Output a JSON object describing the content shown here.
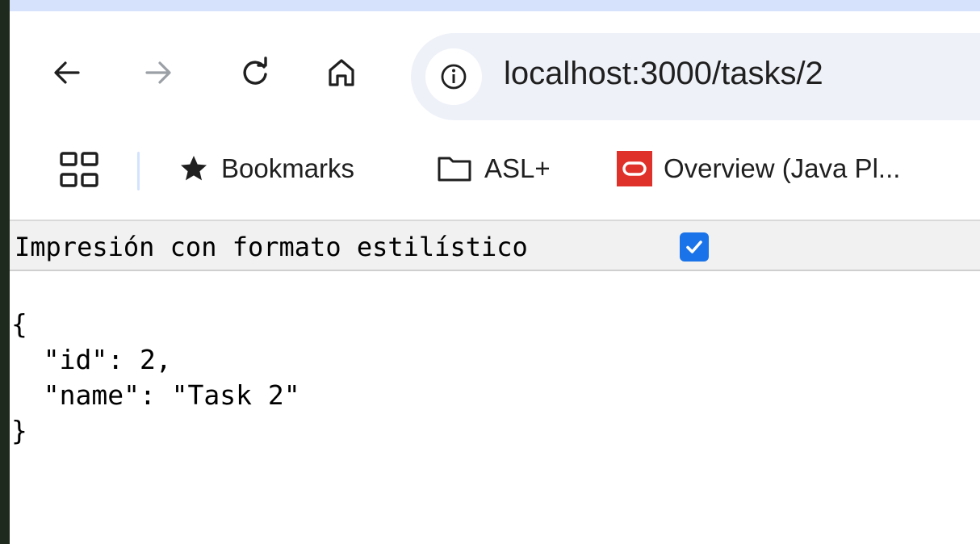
{
  "browser": {
    "url": "localhost:3000/tasks/2",
    "bookmarks": [
      {
        "label": "Bookmarks",
        "icon": "star-icon"
      },
      {
        "label": "ASL+",
        "icon": "folder-icon"
      },
      {
        "label": "Overview (Java Pl...",
        "icon": "oracle-icon"
      }
    ]
  },
  "viewer": {
    "pretty_print_label": "Impresión con formato estilístico",
    "pretty_print_checked": true,
    "json_lines": [
      "{",
      "  \"id\": 2,",
      "  \"name\": \"Task 2\"",
      "}"
    ]
  },
  "colors": {
    "accent": "#1a73e8",
    "oracle_red": "#e0302a",
    "omnibox_bg": "#eef1f8",
    "tab_strip": "#d6e2fb"
  }
}
